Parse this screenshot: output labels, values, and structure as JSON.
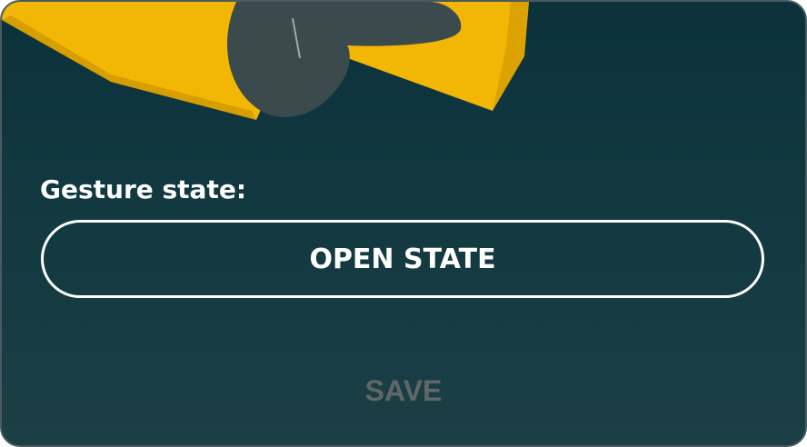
{
  "gesture": {
    "label": "Gesture state:",
    "state_button_label": "OPEN STATE"
  },
  "actions": {
    "save_label": "SAVE",
    "save_enabled": false
  },
  "colors": {
    "background_top": "#0b323b",
    "background_bottom": "#1b3f45",
    "accent_yellow": "#f2b705",
    "illustration_gray": "#3a4a4d",
    "save_disabled": "#5f6768"
  },
  "illustration": {
    "icon": "hand-gesture-illustration"
  }
}
